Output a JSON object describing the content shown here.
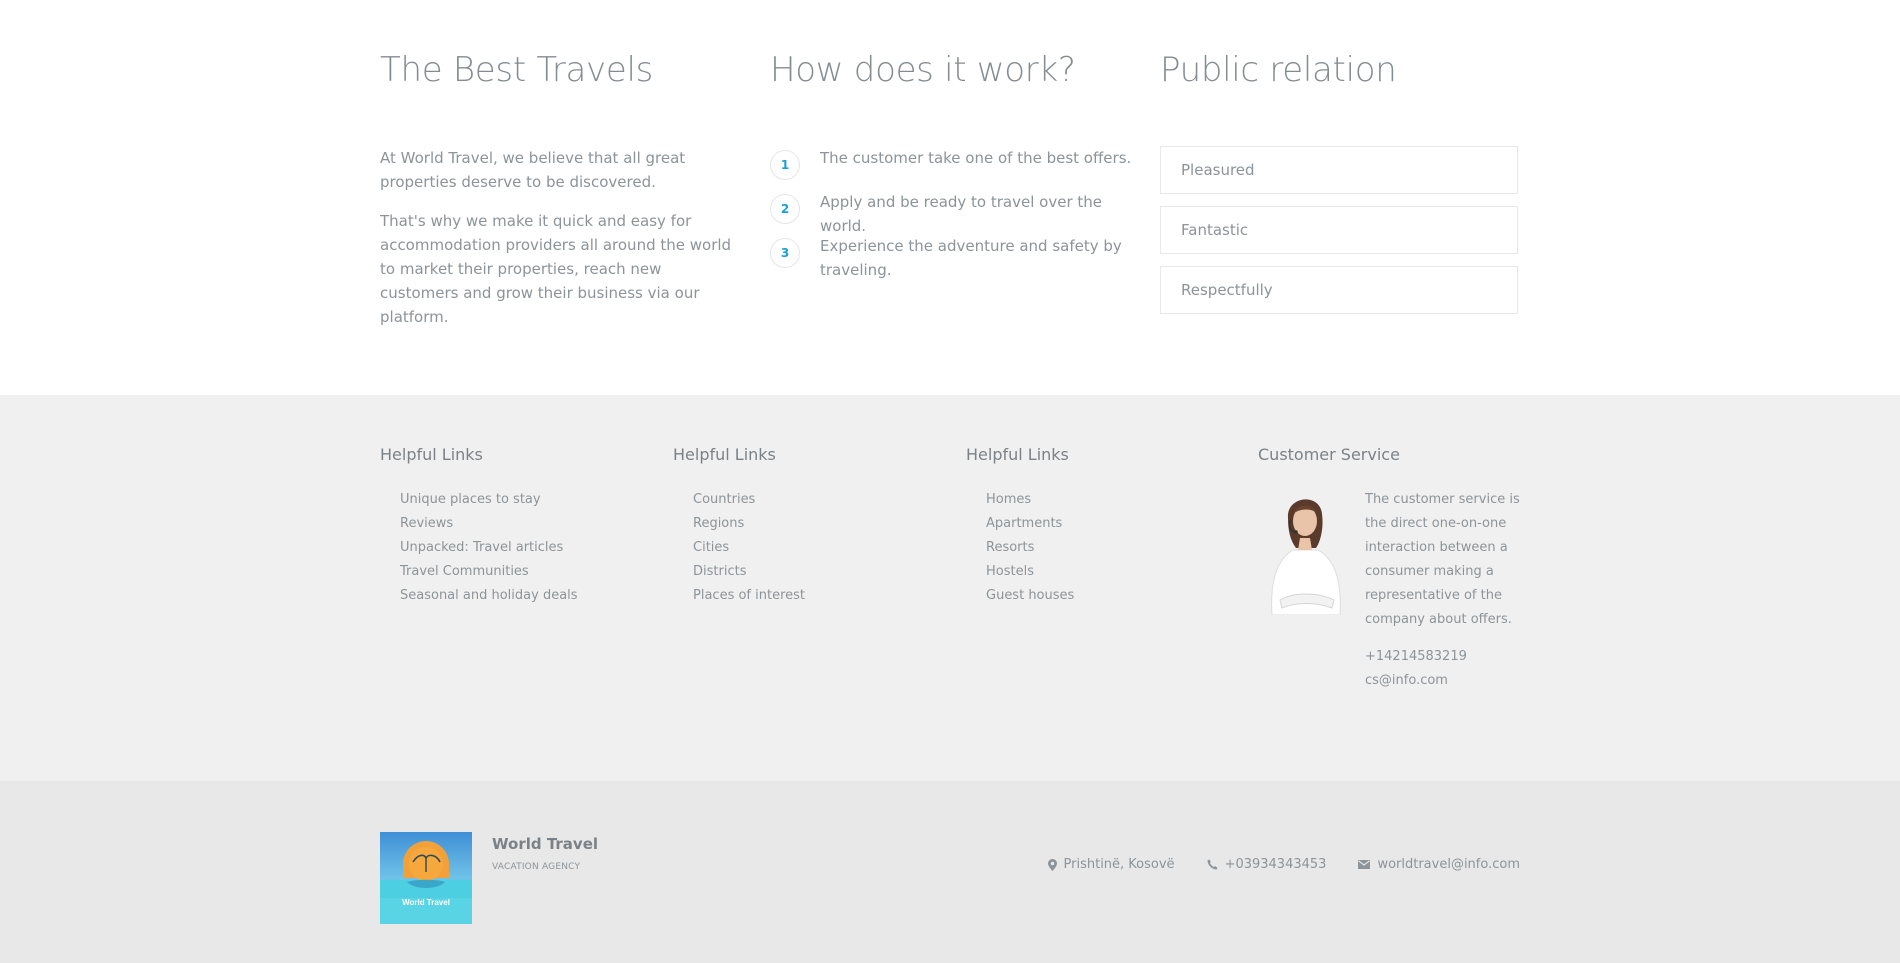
{
  "best_travels": {
    "title": "The Best Travels",
    "paragraph1": "At World Travel, we believe that all great properties deserve to be discovered.",
    "paragraph2": "That's why we make it quick and easy for accommodation providers all around the world to market their properties, reach new customers and grow their business via our platform."
  },
  "how_it_works": {
    "title": "How does it work?",
    "steps": [
      {
        "num": "1",
        "text": "The customer take one of the best offers."
      },
      {
        "num": "2",
        "text": "Apply and be ready to travel over the world."
      },
      {
        "num": "3",
        "text": "Experience the adventure and safety by traveling."
      }
    ]
  },
  "public_relation": {
    "title": "Public relation",
    "items": [
      "Pleasured",
      "Fantastic",
      "Respectfully"
    ]
  },
  "footer": {
    "col1": {
      "title": "Helpful Links",
      "items": [
        "Unique places to stay",
        "Reviews",
        "Unpacked: Travel articles",
        "Travel Communities",
        "Seasonal and holiday deals"
      ]
    },
    "col2": {
      "title": "Helpful Links",
      "items": [
        "Countries",
        "Regions",
        "Cities",
        "Districts",
        "Places of interest"
      ]
    },
    "col3": {
      "title": "Helpful Links",
      "items": [
        "Homes",
        "Apartments",
        "Resorts",
        "Hostels",
        "Guest houses"
      ]
    },
    "customer_service": {
      "title": "Customer Service",
      "text": "The customer service is the direct one-on-one interaction between a consumer making a representative of the company about offers.",
      "phone": "+14214583219",
      "email": "cs@info.com"
    }
  },
  "bottom": {
    "logo_text": "World Travel",
    "brand": "World Travel",
    "tagline": "VACATION AGENCY",
    "location": "Prishtinë, Kosovë",
    "phone": "+03934343453",
    "email": "worldtravel@info.com"
  },
  "colors": {
    "accent": "#1aa0d8",
    "text": "#8c9499",
    "heading": "#858c91",
    "footer_bg": "#f0f0f0",
    "bottom_bg": "#e8e8e8"
  }
}
